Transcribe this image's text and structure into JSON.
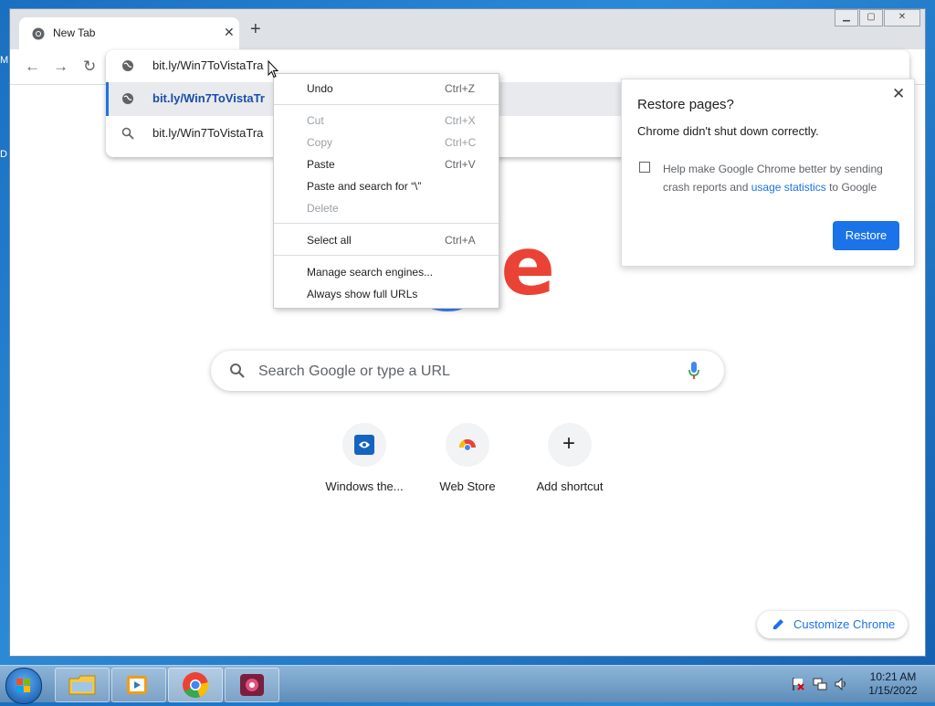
{
  "desktop": {
    "edge_letters": [
      "M",
      "D"
    ]
  },
  "tab": {
    "title": "New Tab"
  },
  "omnibox": {
    "current_text": "bit.ly/Win7ToVistaTra",
    "suggestions": [
      {
        "text": "bit.ly/Win7ToVistaTr",
        "icon": "globe-icon",
        "selected": true
      },
      {
        "text": "bit.ly/Win7ToVistaTra",
        "icon": "search-icon",
        "selected": false
      }
    ]
  },
  "context_menu": {
    "undo": {
      "label": "Undo",
      "shortcut": "Ctrl+Z"
    },
    "cut": {
      "label": "Cut",
      "shortcut": "Ctrl+X"
    },
    "copy": {
      "label": "Copy",
      "shortcut": "Ctrl+C"
    },
    "paste": {
      "label": "Paste",
      "shortcut": "Ctrl+V"
    },
    "paste_search": {
      "label": "Paste and search for “\\”"
    },
    "delete": {
      "label": "Delete"
    },
    "select_all": {
      "label": "Select all",
      "shortcut": "Ctrl+A"
    },
    "manage_engines": {
      "label": "Manage search engines..."
    },
    "show_urls": {
      "label": "Always show full URLs"
    }
  },
  "restore": {
    "title": "Restore pages?",
    "message": "Chrome didn't shut down correctly.",
    "help_prefix": "Help make Google Chrome better by sending crash reports and ",
    "help_link": "usage statistics",
    "help_suffix": " to Google",
    "button": "Restore"
  },
  "ntp": {
    "logo_visible": "gle",
    "search_placeholder": "Search Google or type a URL",
    "shortcuts": [
      {
        "label": "Windows the...",
        "icon": "windows-theme-icon"
      },
      {
        "label": "Web Store",
        "icon": "webstore-icon"
      },
      {
        "label": "Add shortcut",
        "icon": "plus-icon"
      }
    ],
    "customize": "Customize Chrome"
  },
  "taskbar": {
    "time": "10:21 AM",
    "date": "1/15/2022"
  },
  "colors": {
    "accent": "#1a73e8",
    "g_blue": "#4285f4",
    "g_green": "#34a853",
    "g_red": "#ea4335"
  }
}
